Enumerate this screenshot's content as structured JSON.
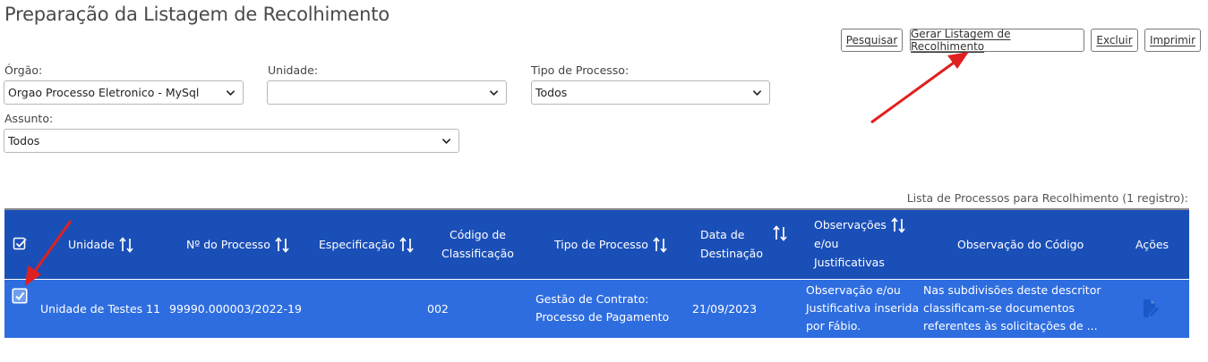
{
  "page": {
    "title": "Preparação da Listagem de Recolhimento"
  },
  "toolbar": {
    "pesquisar": "Pesquisar",
    "gerar": "Gerar Listagem de Recolhimento",
    "excluir": "Excluir",
    "imprimir": "Imprimir"
  },
  "filters": {
    "orgao": {
      "label": "Órgão:",
      "value": "Orgao Processo Eletronico - MySql"
    },
    "unidade": {
      "label": "Unidade:",
      "value": ""
    },
    "tipo": {
      "label": "Tipo de Processo:",
      "value": "Todos"
    },
    "assunto": {
      "label": "Assunto:",
      "value": "Todos"
    }
  },
  "table": {
    "caption": "Lista de Processos para Recolhimento (1 registro):",
    "headers": {
      "unidade": "Unidade",
      "processo": "Nº do Processo",
      "especificacao": "Especificação",
      "codigo_l1": "Código de",
      "codigo_l2": "Classificação",
      "tipo": "Tipo de Processo",
      "data_l1": "Data de",
      "data_l2": "Destinação",
      "obs_l1": "Observações",
      "obs_l2": "e/ou",
      "obs_l3": "Justificativas",
      "obs_codigo": "Observação do Código",
      "acoes": "Ações"
    },
    "rows": [
      {
        "unidade": "Unidade de Testes 11",
        "processo": "99990.000003/2022-19",
        "especificacao": "",
        "codigo": "002",
        "tipo_l1": "Gestão de Contrato:",
        "tipo_l2": "Processo de Pagamento",
        "data": "21/09/2023",
        "obs_l1": "Observação e/ou",
        "obs_l2": "Justificativa inserida",
        "obs_l3": "por Fábio.",
        "obscod_l1": "Nas subdivisões deste descritor",
        "obscod_l2": "classificam-se documentos",
        "obscod_l3": "referentes às solicitações de ...",
        "checked": true
      }
    ]
  },
  "colors": {
    "header": "#1a4fb8",
    "row": "#2e6de0",
    "arrow": "#e02020"
  },
  "icons": [
    "chevron-down-icon",
    "sort-icon",
    "checkbox-icon",
    "edit-document-icon",
    "annotation-arrow"
  ]
}
